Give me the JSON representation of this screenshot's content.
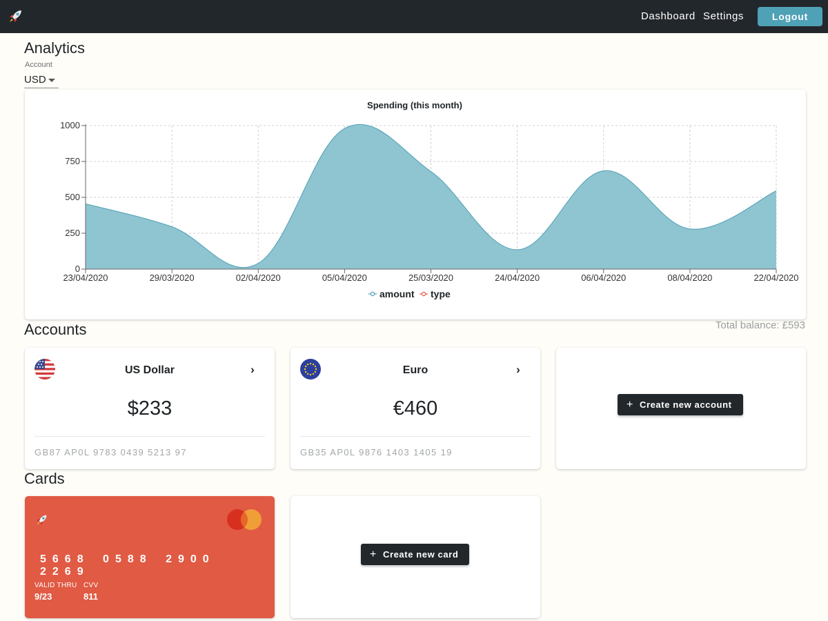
{
  "nav": {
    "logo_icon": "rocket-icon",
    "links": [
      "Dashboard",
      "Settings"
    ],
    "logout_label": "Logout"
  },
  "analytics": {
    "title": "Analytics",
    "account_label": "Account",
    "account_value": "USD"
  },
  "chart_data": {
    "type": "area",
    "title": "Spending (this month)",
    "categories": [
      "23/04/2020",
      "29/03/2020",
      "02/04/2020",
      "05/04/2020",
      "25/03/2020",
      "24/04/2020",
      "06/04/2020",
      "08/04/2020",
      "22/04/2020"
    ],
    "series": [
      {
        "name": "amount",
        "values": [
          455,
          295,
          40,
          980,
          680,
          135,
          685,
          280,
          545
        ],
        "color": "#4e9fb4"
      },
      {
        "name": "type",
        "values": [],
        "color": "#e05a44"
      }
    ],
    "y_ticks": [
      0,
      250,
      500,
      750,
      1000
    ],
    "ylim": [
      0,
      1000
    ],
    "grid": true,
    "legend_position": "bottom-center"
  },
  "accounts": {
    "title": "Accounts",
    "total_balance": "Total balance: £593",
    "items": [
      {
        "flag_icon": "us-flag-icon",
        "name": "US Dollar",
        "amount": "$233",
        "iban": "GB87 AP0L 9783 0439 5213 97"
      },
      {
        "flag_icon": "eu-flag-icon",
        "name": "Euro",
        "amount": "€460",
        "iban": "GB35 AP0L 9876 1403 1405 19"
      }
    ],
    "create_label": "Create new account"
  },
  "cards": {
    "title": "Cards",
    "card": {
      "number": "5668 0588 2900 2269",
      "valid_label": "VALID THRU",
      "valid_value": "9/23",
      "cvv_label": "CVV",
      "cvv_value": "811",
      "brand_icon": "mastercard-icon",
      "color": "#e05a44"
    },
    "create_label": "Create new card"
  },
  "colors": {
    "topbar": "#22272b",
    "accent": "#4fa1b6",
    "area_fill": "#8fc4d1",
    "area_stroke": "#4e9fb4",
    "card_red": "#e05a44"
  }
}
